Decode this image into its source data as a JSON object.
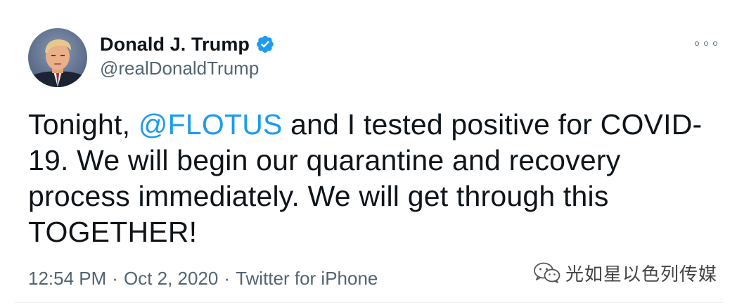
{
  "author": {
    "display_name": "Donald J. Trump",
    "handle": "@realDonaldTrump",
    "verified": true,
    "verified_color": "#1d9bf0"
  },
  "tweet": {
    "text_before": "Tonight, ",
    "mention": "@FLOTUS",
    "text_after": " and I tested positive for COVID-19. We will begin our quarantine and recovery process immediately. We will get through this TOGETHER!",
    "mention_color": "#1d9bf0"
  },
  "meta": {
    "time": "12:54 PM",
    "date": "Oct 2, 2020",
    "source": "Twitter for iPhone",
    "separator": "·"
  },
  "watermark": {
    "text": "光如星以色列传媒",
    "icon": "wechat-icon"
  },
  "icons": {
    "more": "more-options-icon",
    "verified": "verified-badge-icon",
    "avatar": "avatar"
  }
}
